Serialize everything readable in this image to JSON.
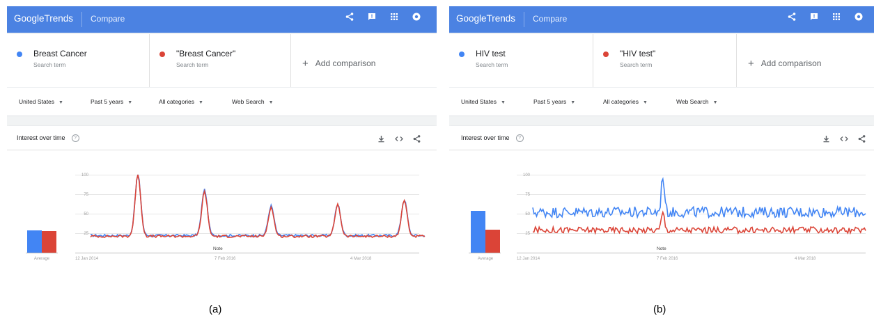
{
  "colors": {
    "blue": "#4285f4",
    "red": "#db4437",
    "appbar": "#4b82e2"
  },
  "panels": [
    {
      "caption": "(a)",
      "app": {
        "logo_google": "Google",
        "logo_trends": "Trends",
        "title": "Compare"
      },
      "terms": [
        {
          "label": "Breast Cancer",
          "sub": "Search term",
          "color": "#4285f4"
        },
        {
          "label": "\"Breast Cancer\"",
          "sub": "Search term",
          "color": "#db4437"
        }
      ],
      "add_comparison": "Add comparison",
      "filters": [
        "United States",
        "Past 5 years",
        "All categories",
        "Web Search"
      ],
      "card_title": "Interest over time",
      "icons": [
        "share-icon",
        "feedback-icon",
        "apps-icon",
        "account-icon",
        "download-icon",
        "embed-icon",
        "share-icon"
      ]
    },
    {
      "caption": "(b)",
      "app": {
        "logo_google": "Google",
        "logo_trends": "Trends",
        "title": "Compare"
      },
      "terms": [
        {
          "label": "HIV test",
          "sub": "Search term",
          "color": "#4285f4"
        },
        {
          "label": "\"HIV test\"",
          "sub": "Search term",
          "color": "#db4437"
        }
      ],
      "add_comparison": "Add comparison",
      "filters": [
        "United States",
        "Past 5 years",
        "All categories",
        "Web Search"
      ],
      "card_title": "Interest over time",
      "icons": [
        "share-icon",
        "feedback-icon",
        "apps-icon",
        "account-icon",
        "download-icon",
        "embed-icon",
        "share-icon"
      ]
    }
  ],
  "chart_data": [
    {
      "type": "line",
      "y_ticks": [
        "100",
        "75",
        "50",
        "25"
      ],
      "ylim": [
        0,
        100
      ],
      "x_ticks": [
        "12 Jan 2014",
        "7 Feb 2016",
        "4 Mar 2018"
      ],
      "note": "Note",
      "average_label": "Average",
      "averages": [
        {
          "color": "#4285f4",
          "value": 26
        },
        {
          "color": "#db4437",
          "value": 25
        }
      ],
      "series": [
        {
          "color": "#4285f4",
          "baseline": 22,
          "noise": 1.5,
          "peaks": [
            {
              "week": 37,
              "value": 100
            },
            {
              "week": 89,
              "value": 81
            },
            {
              "week": 141,
              "value": 60
            },
            {
              "week": 193,
              "value": 62
            },
            {
              "week": 245,
              "value": 68
            }
          ]
        },
        {
          "color": "#db4437",
          "baseline": 21,
          "noise": 1.5,
          "peaks": [
            {
              "week": 37,
              "value": 100
            },
            {
              "week": 89,
              "value": 78
            },
            {
              "week": 141,
              "value": 58
            },
            {
              "week": 193,
              "value": 62
            },
            {
              "week": 245,
              "value": 67
            }
          ]
        }
      ]
    },
    {
      "type": "line",
      "y_ticks": [
        "100",
        "75",
        "50",
        "25"
      ],
      "ylim": [
        0,
        100
      ],
      "x_ticks": [
        "12 Jan 2014",
        "7 Feb 2016",
        "4 Mar 2018"
      ],
      "note": "Note",
      "average_label": "Average",
      "averages": [
        {
          "color": "#4285f4",
          "value": 53
        },
        {
          "color": "#db4437",
          "value": 29
        }
      ],
      "series": [
        {
          "color": "#4285f4",
          "baseline": 52,
          "noise": 7,
          "peaks": [
            {
              "week": 102,
              "value": 100
            }
          ]
        },
        {
          "color": "#db4437",
          "baseline": 29,
          "noise": 4,
          "peaks": [
            {
              "week": 102,
              "value": 52
            }
          ]
        }
      ]
    }
  ]
}
